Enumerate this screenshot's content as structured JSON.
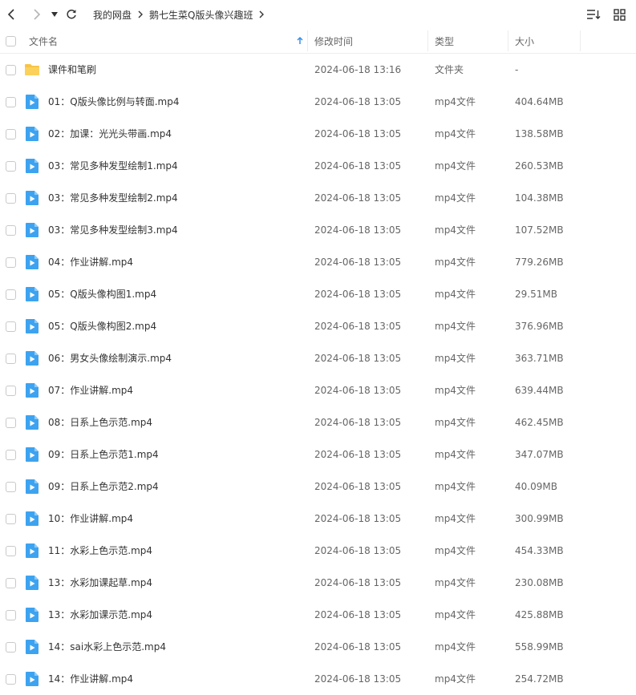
{
  "breadcrumb": {
    "items": [
      "我的网盘",
      "鹅七生菜Q版头像兴趣班"
    ]
  },
  "columns": {
    "name": "文件名",
    "modified": "修改时间",
    "type": "类型",
    "size": "大小"
  },
  "colors": {
    "folder": "#f7c447",
    "video": "#3da3f0",
    "sort_arrow": "#3a8ee6"
  },
  "files": [
    {
      "name": "课件和笔刷",
      "time": "2024-06-18 13:16",
      "type": "文件夹",
      "size": "-",
      "icon": "folder-icon"
    },
    {
      "name": "01：Q版头像比例与转面.mp4",
      "time": "2024-06-18 13:05",
      "type": "mp4文件",
      "size": "404.64MB",
      "icon": "video-file-icon"
    },
    {
      "name": "02：加课：光光头带画.mp4",
      "time": "2024-06-18 13:05",
      "type": "mp4文件",
      "size": "138.58MB",
      "icon": "video-file-icon"
    },
    {
      "name": "03：常见多种发型绘制1.mp4",
      "time": "2024-06-18 13:05",
      "type": "mp4文件",
      "size": "260.53MB",
      "icon": "video-file-icon"
    },
    {
      "name": "03：常见多种发型绘制2.mp4",
      "time": "2024-06-18 13:05",
      "type": "mp4文件",
      "size": "104.38MB",
      "icon": "video-file-icon"
    },
    {
      "name": "03：常见多种发型绘制3.mp4",
      "time": "2024-06-18 13:05",
      "type": "mp4文件",
      "size": "107.52MB",
      "icon": "video-file-icon"
    },
    {
      "name": "04：作业讲解.mp4",
      "time": "2024-06-18 13:05",
      "type": "mp4文件",
      "size": "779.26MB",
      "icon": "video-file-icon"
    },
    {
      "name": "05：Q版头像构图1.mp4",
      "time": "2024-06-18 13:05",
      "type": "mp4文件",
      "size": "29.51MB",
      "icon": "video-file-icon"
    },
    {
      "name": "05：Q版头像构图2.mp4",
      "time": "2024-06-18 13:05",
      "type": "mp4文件",
      "size": "376.96MB",
      "icon": "video-file-icon"
    },
    {
      "name": "06：男女头像绘制演示.mp4",
      "time": "2024-06-18 13:05",
      "type": "mp4文件",
      "size": "363.71MB",
      "icon": "video-file-icon"
    },
    {
      "name": "07：作业讲解.mp4",
      "time": "2024-06-18 13:05",
      "type": "mp4文件",
      "size": "639.44MB",
      "icon": "video-file-icon"
    },
    {
      "name": "08：日系上色示范.mp4",
      "time": "2024-06-18 13:05",
      "type": "mp4文件",
      "size": "462.45MB",
      "icon": "video-file-icon"
    },
    {
      "name": "09：日系上色示范1.mp4",
      "time": "2024-06-18 13:05",
      "type": "mp4文件",
      "size": "347.07MB",
      "icon": "video-file-icon"
    },
    {
      "name": "09：日系上色示范2.mp4",
      "time": "2024-06-18 13:05",
      "type": "mp4文件",
      "size": "40.09MB",
      "icon": "video-file-icon"
    },
    {
      "name": "10：作业讲解.mp4",
      "time": "2024-06-18 13:05",
      "type": "mp4文件",
      "size": "300.99MB",
      "icon": "video-file-icon"
    },
    {
      "name": "11：水彩上色示范.mp4",
      "time": "2024-06-18 13:05",
      "type": "mp4文件",
      "size": "454.33MB",
      "icon": "video-file-icon"
    },
    {
      "name": "13：水彩加课起草.mp4",
      "time": "2024-06-18 13:05",
      "type": "mp4文件",
      "size": "230.08MB",
      "icon": "video-file-icon"
    },
    {
      "name": "13：水彩加课示范.mp4",
      "time": "2024-06-18 13:05",
      "type": "mp4文件",
      "size": "425.88MB",
      "icon": "video-file-icon"
    },
    {
      "name": "14：sai水彩上色示范.mp4",
      "time": "2024-06-18 13:05",
      "type": "mp4文件",
      "size": "558.99MB",
      "icon": "video-file-icon"
    },
    {
      "name": "14：作业讲解.mp4",
      "time": "2024-06-18 13:05",
      "type": "mp4文件",
      "size": "254.72MB",
      "icon": "video-file-icon"
    }
  ]
}
